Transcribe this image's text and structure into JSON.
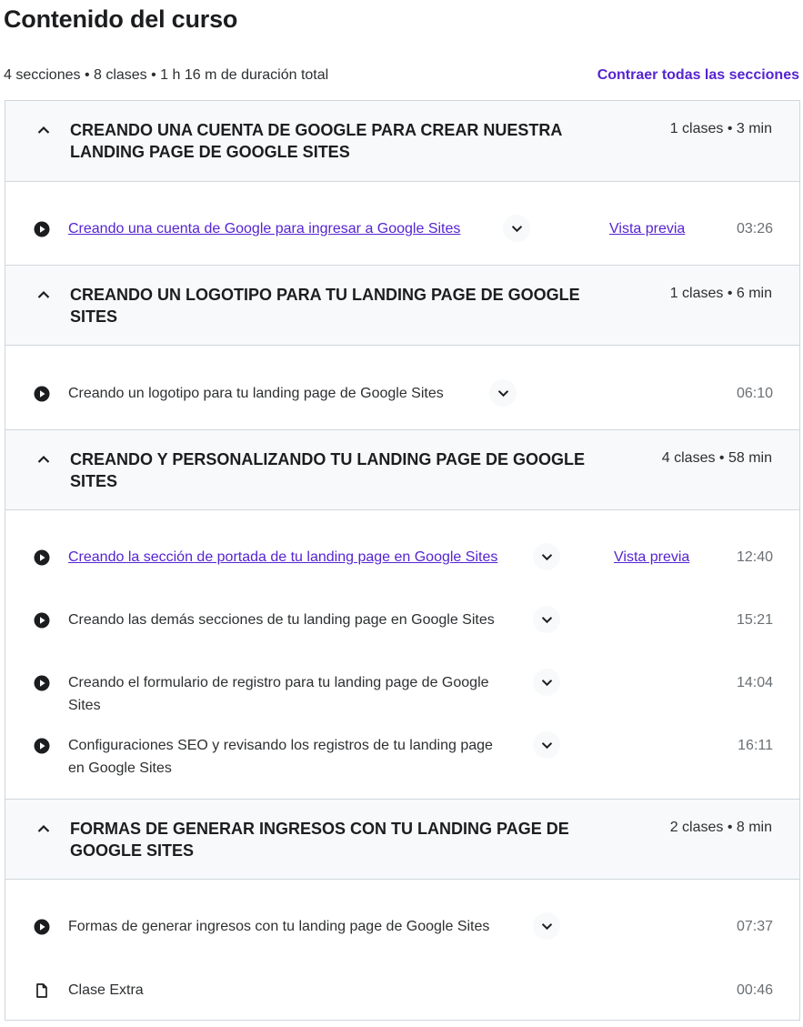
{
  "header": {
    "title": "Contenido del curso",
    "summary": "4 secciones • 8 clases • 1 h 16 m de duración total",
    "collapse_all": "Contraer todas las secciones"
  },
  "colors": {
    "accent": "#5624d0",
    "header_bg": "#f7f9fa",
    "border": "#d1d7dc",
    "text": "#1c1d1f",
    "muted": "#6a6f73"
  },
  "sections": [
    {
      "title": "Creando una cuenta de Google para crear nuestra landing page de Google Sites",
      "meta": "1 clases • 3 min",
      "lessons": [
        {
          "title": "Creando una cuenta de Google para ingresar a Google Sites",
          "preview": "Vista previa",
          "duration": "03:26",
          "icon": "play-circle-icon"
        }
      ]
    },
    {
      "title": "Creando un logotipo para tu landing page de Google Sites",
      "meta": "1 clases • 6 min",
      "lessons": [
        {
          "title": "Creando un logotipo para tu landing page de Google Sites",
          "duration": "06:10",
          "icon": "play-circle-icon"
        }
      ]
    },
    {
      "title": "Creando y personalizando tu landing page de Google Sites",
      "meta": "4 clases • 58 min",
      "lessons": [
        {
          "title": "Creando la sección de portada de tu landing page en Google Sites",
          "preview": "Vista previa",
          "duration": "12:40",
          "icon": "play-circle-icon"
        },
        {
          "title": "Creando las demás secciones de tu landing page en Google Sites",
          "duration": "15:21",
          "icon": "play-circle-icon"
        },
        {
          "title": "Creando el formulario de registro para tu landing page de Google Sites",
          "duration": "14:04",
          "icon": "play-circle-icon"
        },
        {
          "title": "Configuraciones SEO y revisando los registros de tu landing page en Google Sites",
          "duration": "16:11",
          "icon": "play-circle-icon"
        }
      ]
    },
    {
      "title": "Formas de generar ingresos con tu landing page de Google Sites",
      "meta": "2 clases • 8 min",
      "lessons": [
        {
          "title": "Formas de generar ingresos con tu landing page de Google Sites",
          "duration": "07:37",
          "icon": "play-circle-icon"
        },
        {
          "title": "Clase Extra",
          "duration": "00:46",
          "icon": "file-icon"
        }
      ]
    }
  ]
}
